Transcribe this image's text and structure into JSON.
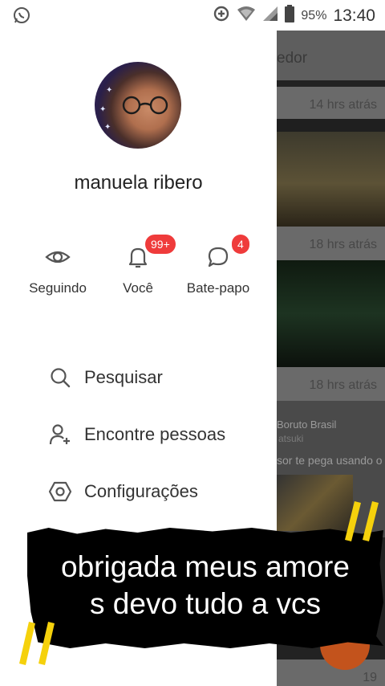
{
  "status_bar": {
    "battery_percent": "95%",
    "time": "13:40",
    "icons": [
      "whatsapp-icon",
      "data-saver-icon",
      "wifi-icon",
      "signal-icon",
      "battery-icon"
    ]
  },
  "drawer": {
    "username": "manuela ribero",
    "tabs": [
      {
        "label": "Seguindo",
        "icon": "eye-icon",
        "badge": ""
      },
      {
        "label": "Você",
        "icon": "bell-icon",
        "badge": "99+"
      },
      {
        "label": "Bate-papo",
        "icon": "chat-bubble-icon",
        "badge": "4"
      }
    ],
    "menu": [
      {
        "label": "Pesquisar",
        "icon": "search-icon"
      },
      {
        "label": "Encontre pessoas",
        "icon": "add-person-icon"
      },
      {
        "label": "Configurações",
        "icon": "settings-hexagon-icon"
      }
    ]
  },
  "feed": {
    "header_fragment": "edor",
    "timestamps": [
      "14 hrs atrás",
      "18 hrs atrás",
      "18 hrs atrás",
      "19"
    ],
    "card": {
      "title": "Boruto Brasil",
      "subtitle": "atsuki",
      "description": "sor te pega usando o"
    }
  },
  "caption": {
    "line1": "obrigada meus amore",
    "line2": "s devo tudo a vcs"
  },
  "colors": {
    "badge": "#ef3b3b",
    "accent_quotes": "#f5d10c",
    "fab": "#c3531c"
  }
}
